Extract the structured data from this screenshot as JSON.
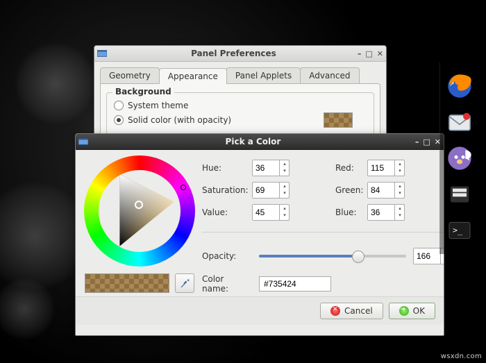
{
  "watermark": "wsxdn.com",
  "dock": {
    "items": [
      "firefox",
      "mail",
      "pidgin",
      "files",
      "terminal"
    ]
  },
  "prefs": {
    "title": "Panel Preferences",
    "tabs": [
      "Geometry",
      "Appearance",
      "Panel Applets",
      "Advanced"
    ],
    "active_tab": 1,
    "background": {
      "legend": "Background",
      "options": [
        "System theme",
        "Solid color (with opacity)"
      ],
      "selected": 1
    }
  },
  "picker": {
    "title": "Pick a Color",
    "labels": {
      "hue": "Hue:",
      "saturation": "Saturation:",
      "value": "Value:",
      "red": "Red:",
      "green": "Green:",
      "blue": "Blue:",
      "opacity": "Opacity:",
      "color_name": "Color name:"
    },
    "hsv": {
      "hue": 36,
      "saturation": 69,
      "value": 45
    },
    "rgb": {
      "red": 115,
      "green": 84,
      "blue": 36
    },
    "opacity": 166,
    "color_name": "#735424",
    "buttons": {
      "cancel": "Cancel",
      "ok": "OK"
    }
  }
}
